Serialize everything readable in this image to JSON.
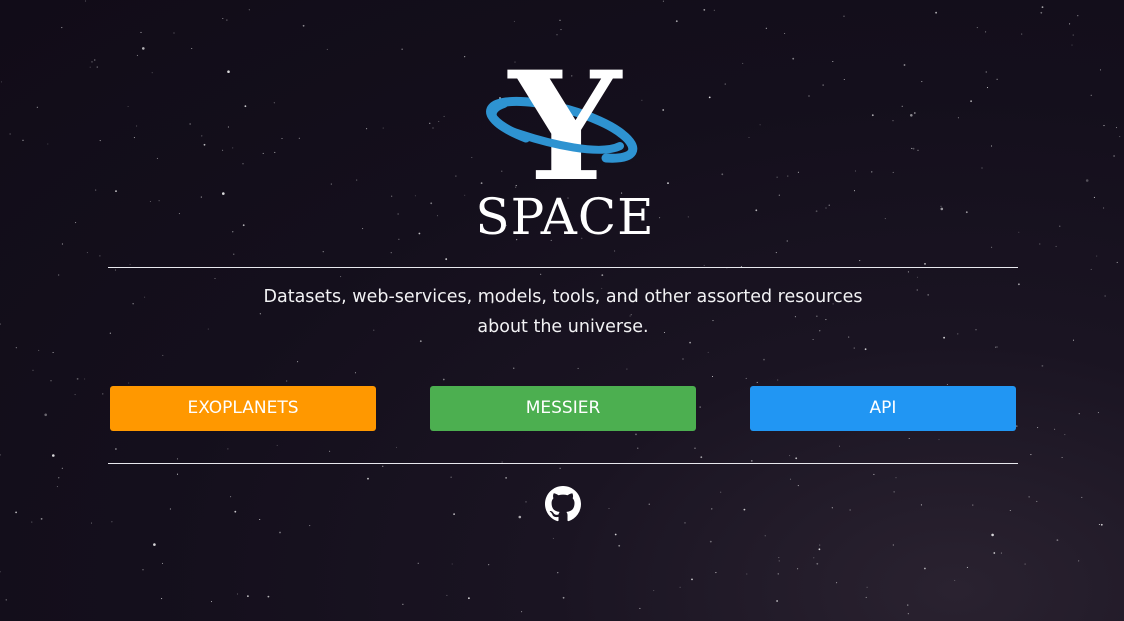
{
  "brand": {
    "logo_letter": "Y",
    "logo_word": "SPACE",
    "ring_color": "#2e93d1"
  },
  "tagline": {
    "line1": "Datasets, web-services, models, tools, and other assorted resources",
    "line2": "about the universe."
  },
  "buttons": [
    {
      "label": "EXOPLANETS",
      "color": "#ff9800"
    },
    {
      "label": "MESSIER",
      "color": "#4caf50"
    },
    {
      "label": "API",
      "color": "#2196f3"
    }
  ],
  "footer": {
    "icon": "github-icon"
  },
  "colors": {
    "background": "#140f1c",
    "rule": "#e8e8ee"
  }
}
